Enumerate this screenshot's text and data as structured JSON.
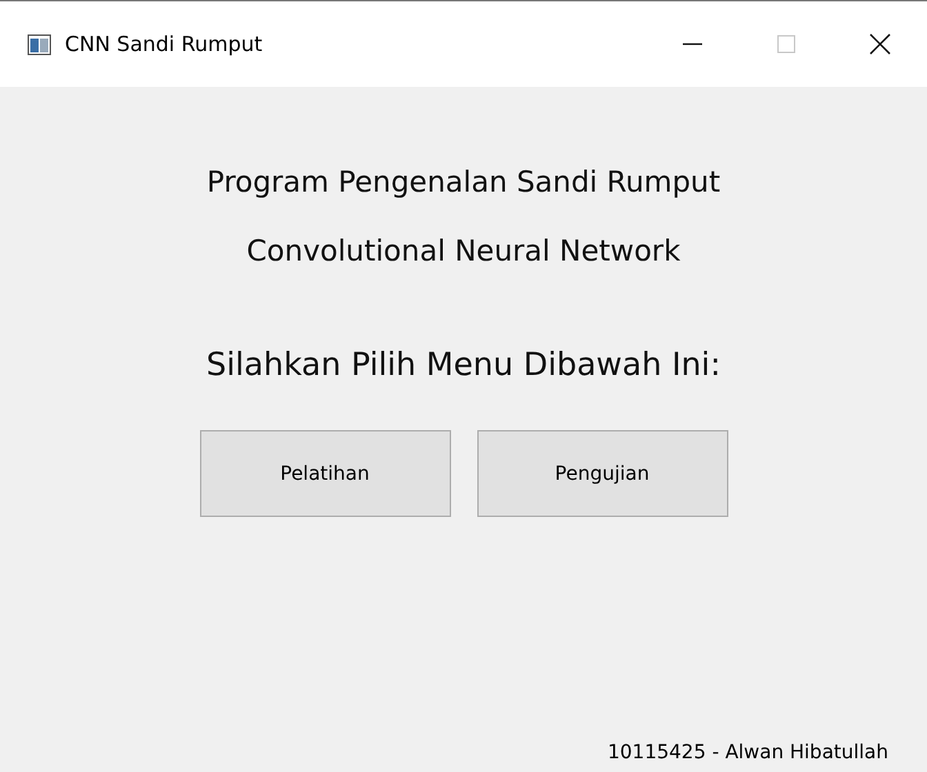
{
  "window": {
    "title": "CNN Sandi Rumput",
    "maximize_disabled": true
  },
  "headings": [
    "Program Pengenalan Sandi Rumput",
    "Convolutional Neural Network"
  ],
  "prompt": "Silahkan Pilih Menu Dibawah Ini:",
  "buttons": [
    "Pelatihan",
    "Pengujian"
  ],
  "footer": "10115425 - Alwan Hibatullah"
}
